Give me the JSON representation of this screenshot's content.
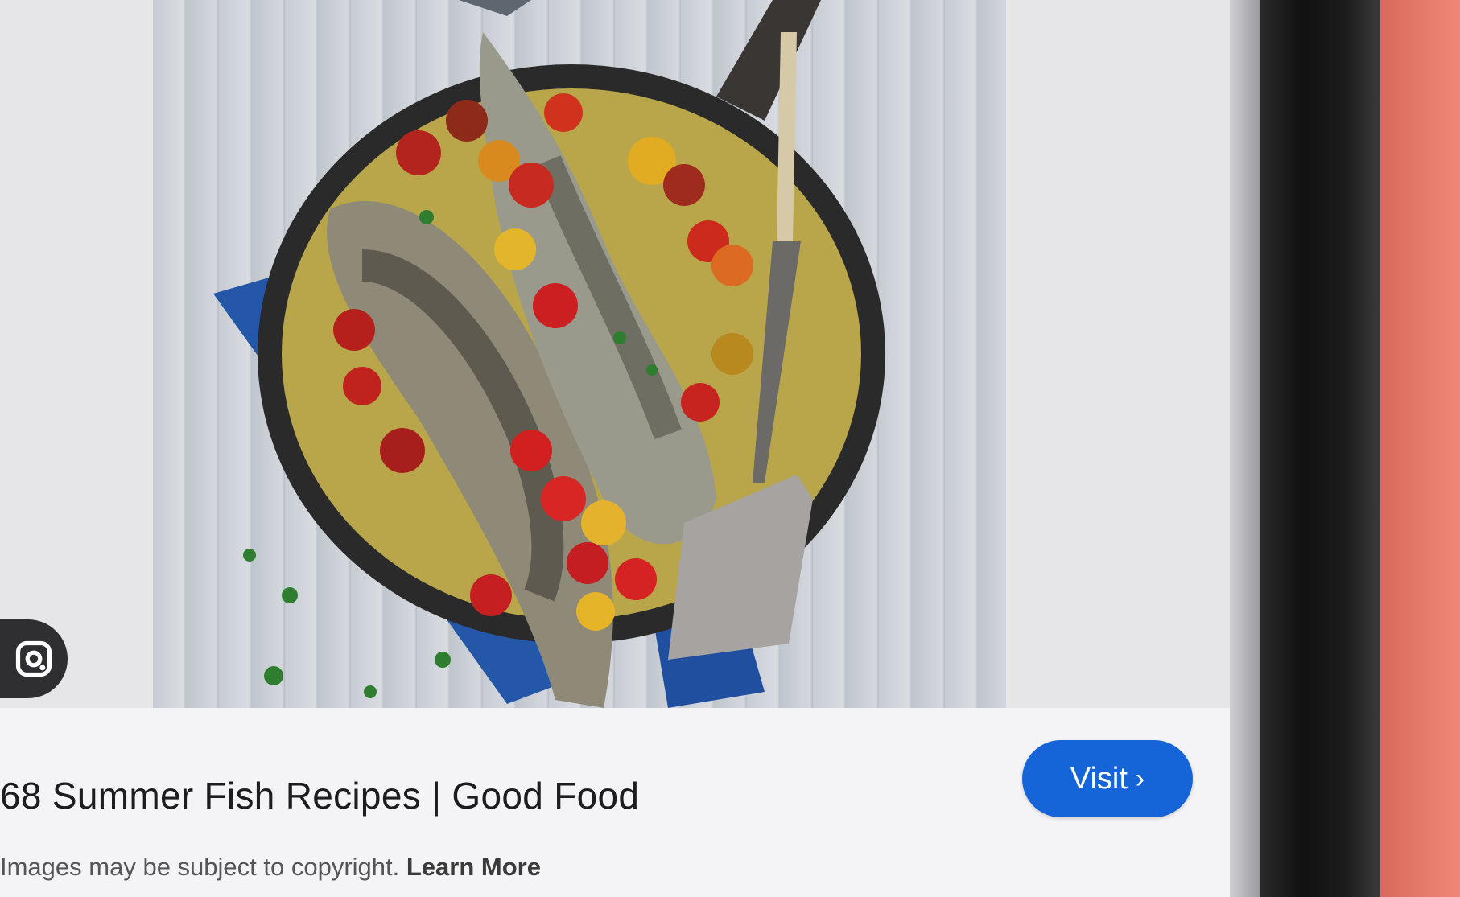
{
  "result": {
    "title": "68 Summer Fish Recipes | Good Food",
    "visit_label": "Visit",
    "visit_icon": "chevron-right-icon"
  },
  "notice": {
    "text": "Images may be subject to copyright.",
    "link": "Learn More"
  },
  "icons": {
    "lens": "google-lens-icon"
  },
  "colors": {
    "visit_button": "#1565d8",
    "panel_bg": "#f4f4f6",
    "title_text": "#1d1d1f"
  }
}
